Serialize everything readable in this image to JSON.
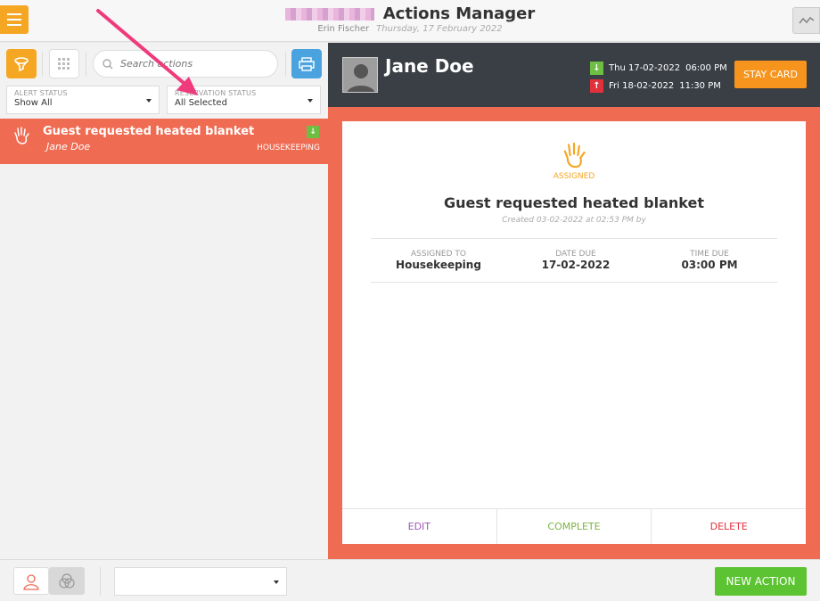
{
  "header": {
    "app_title": "Actions Manager",
    "user_name": "Erin Fischer",
    "date": "Thursday, 17 February 2022"
  },
  "toolbar": {
    "search_placeholder": "Search actions"
  },
  "filters": {
    "alert_status_label": "ALERT STATUS",
    "alert_status_value": "Show All",
    "reservation_status_label": "RESERVATION STATUS",
    "reservation_status_value": "All Selected"
  },
  "action_list": [
    {
      "title": "Guest requested heated blanket",
      "guest": "Jane Doe",
      "department": "HOUSEKEEPING",
      "arrow": "↓"
    }
  ],
  "guest": {
    "name": "Jane Doe",
    "arrival": "Thu 17-02-2022",
    "arrival_time": "06:00 PM",
    "departure": "Fri 18-02-2022",
    "departure_time": "11:30 PM",
    "stay_card_label": "STAY CARD"
  },
  "detail": {
    "status": "ASSIGNED",
    "title": "Guest requested heated blanket",
    "created": "Created 03-02-2022 at 02:53 PM by",
    "assigned_to_label": "ASSIGNED TO",
    "assigned_to": "Housekeeping",
    "date_due_label": "DATE DUE",
    "date_due": "17-02-2022",
    "time_due_label": "TIME DUE",
    "time_due": "03:00 PM",
    "edit_label": "EDIT",
    "complete_label": "COMPLETE",
    "delete_label": "DELETE"
  },
  "bottom": {
    "new_action_label": "NEW ACTION",
    "select_value": ""
  },
  "colors": {
    "accent_orange": "#f5a623",
    "alert_red": "#ef6b52",
    "dark_header": "#3a3f45",
    "edit_purple": "#9b59b6",
    "complete_green": "#7cb342",
    "delete_red": "#e0303c",
    "new_action_green": "#5cc332",
    "pointer_pink": "#ef3a7b"
  }
}
